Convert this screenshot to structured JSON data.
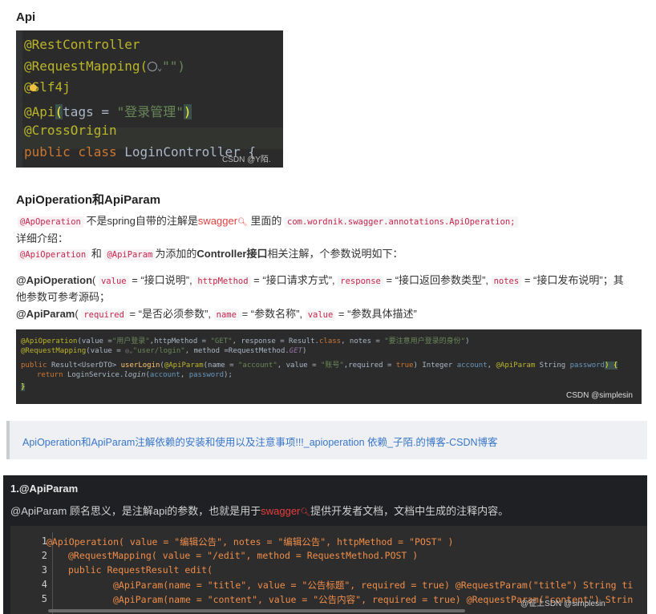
{
  "section_api": {
    "heading": "Api"
  },
  "code1": {
    "lines": [
      "@RestController",
      "@RequestMapping(",
      "\"\")",
      "@Slf4j",
      "@Api",
      "(",
      "tags = ",
      "\"登录管理\"",
      ")",
      "@CrossOrigin",
      "public class ",
      "LoginController {"
    ],
    "watermark": "CSDN @Y陌."
  },
  "section_op": {
    "heading": "ApiOperation和ApiParam",
    "line1_code1": "@ApOperation",
    "line1_text1": "不是spring自带的注解是",
    "line1_link": "swagger",
    "line1_text2": "里面的",
    "line1_code2": "com.wordnik.swagger.annotations.ApiOperation;",
    "line2": "详细介绍：",
    "line3_code1": "@ApiOperation",
    "line3_and": "和",
    "line3_code2": "@ApiParam",
    "line3_text1": "为添加的",
    "line3_bold": "Controller接口",
    "line3_text2": "相关注解，个参数说明如下：",
    "p1_name": "@ApiOperation",
    "p1_paren": "(",
    "p1_c1": "value",
    "p1_t1": "= “接口说明”,",
    "p1_c2": "httpMethod",
    "p1_t2": "= “接口请求方式”,",
    "p1_c3": "response",
    "p1_t3": "= “接口返回参数类型”,",
    "p1_c4": "notes",
    "p1_t4": "= “接口发布说明”；其",
    "p1_line2": "他参数可参考源码；",
    "p2_name": "@ApiParam",
    "p2_paren": "(",
    "p2_c1": "required",
    "p2_t1": "= “是否必须参数”,",
    "p2_c2": "name",
    "p2_t2": "= “参数名称”,",
    "p2_c3": "value",
    "p2_t3": "= “参数具体描述”"
  },
  "code2": {
    "l1a": "@ApiOperation",
    "l1b": "(value =",
    "l1c": "\"用户登录\"",
    "l1d": ",httpMethod = ",
    "l1e": "\"GET\"",
    "l1f": ", response = Result.",
    "l1g": "class",
    "l1h": ", notes = ",
    "l1i": "\"要注意用户登录的身份\"",
    "l1j": ")",
    "l2a": "@RequestMapping",
    "l2b": "(value = ",
    "l2c": "\"user/login\"",
    "l2d": ", method =RequestMethod.",
    "l2e": "GET",
    "l2f": ")",
    "l3a": "public ",
    "l3b": "Result<UserDTO> ",
    "l3c": "userLogin",
    "l3d": "(",
    "l3e": "@ApiParam",
    "l3f": "(name = ",
    "l3g": "\"account\"",
    "l3h": ", value = ",
    "l3i": "\"账号\"",
    "l3j": ",required = ",
    "l3k": "true",
    "l3l": ") Integer ",
    "l3m": "account",
    "l3n": ", ",
    "l3o": "@ApiParam",
    "l3p": " String ",
    "l3q": "password",
    "l3r": ") {",
    "l4a": "return ",
    "l4b": "LoginService.",
    "l4c": "login",
    "l4d": "(",
    "l4e": "account",
    "l4f": ", ",
    "l4g": "password",
    "l4h": ");",
    "l5": "}",
    "watermark": "CSDN @simplesin"
  },
  "link_card": {
    "text": "ApiOperation和ApiParam注解依赖的安装和使用以及注意事项!!!_apioperation 依赖_子陌.的博客-CSDN博客"
  },
  "section_param": {
    "heading": "1.@ApiParam",
    "desc1": "@ApiParam 顾名思义，是注解api的参数，也就是用于",
    "desc_link": "swagger",
    "desc2": "提供开发者文档，文档中生成的注释内容。",
    "line_numbers": [
      "1",
      "2",
      "3",
      "4",
      "5"
    ],
    "code_lines": [
      "@ApiOperation( value = \"编辑公告\", notes = \"编辑公告\", httpMethod = \"POST\" )",
      "@RequestMapping( value = \"/edit\", method = RequestMethod.POST )",
      "public RequestResult edit(",
      "@ApiParam(name = \"title\", value = \"公告标题\", required = true) @RequestParam(\"title\") String ti",
      "@ApiParam(name = \"content\", value = \"公告内容\", required = true) @RequestParam(\"content\") Strin"
    ],
    "watermark": "@征上SDN @simplesin"
  },
  "colors": {
    "link": "#3876c7",
    "inline_code": "#c7254e",
    "swagger_red": "#e83e3e"
  }
}
